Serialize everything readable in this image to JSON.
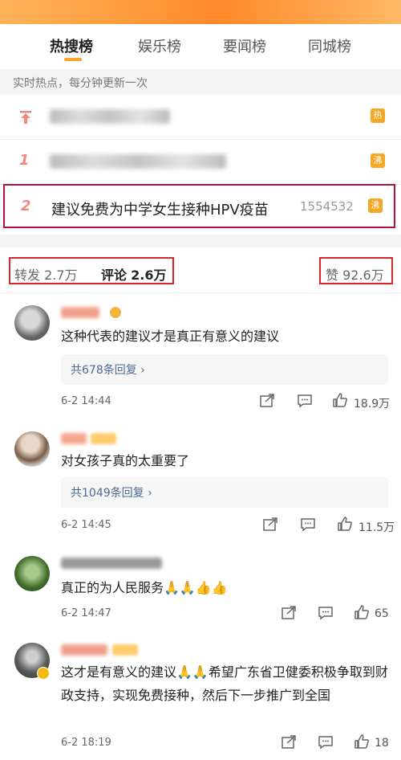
{
  "tabs": [
    {
      "label": "热搜榜",
      "active": true
    },
    {
      "label": "娱乐榜",
      "active": false
    },
    {
      "label": "要闻榜",
      "active": false
    },
    {
      "label": "同城榜",
      "active": false
    }
  ],
  "subheader": "实时热点，每分钟更新一次",
  "hot_list": [
    {
      "rank_icon": "pin-up-icon",
      "badge": "热",
      "badge_color": "#f5a623"
    },
    {
      "rank": "1",
      "badge": "沸",
      "badge_color": "#f5a623"
    },
    {
      "rank": "2",
      "title": "建议免费为中学女生接种HPV疫苗",
      "count": "1554532",
      "badge": "沸",
      "badge_color": "#f5a623"
    }
  ],
  "stats": {
    "repost_label": "转发",
    "repost_value": "2.7万",
    "comment_label": "评论",
    "comment_value": "2.6万",
    "like_label": "赞",
    "like_value": "92.6万"
  },
  "comments": [
    {
      "text": "这种代表的建议才是真正有意义的建议",
      "reply": "共678条回复 ›",
      "time": "6-2 14:44",
      "likes": "18.9万"
    },
    {
      "text": "对女孩子真的太重要了",
      "reply": "共1049条回复 ›",
      "time": "6-2 14:45",
      "likes": "11.5万"
    },
    {
      "text": "真正的为人民服务🙏🙏👍👍",
      "time": "6-2 14:47",
      "likes": "65"
    },
    {
      "text": "这才是有意义的建议🙏🙏希望广东省卫健委积极争取到财政支持，实现免费接种，然后下一步推广到全国",
      "time": "6-2 18:19",
      "likes": "18"
    }
  ],
  "colors": {
    "accent": "#f5a623",
    "highlight_border": "#b2123a",
    "stat_box_border": "#d9262b",
    "reply_link": "#4e6b94"
  }
}
